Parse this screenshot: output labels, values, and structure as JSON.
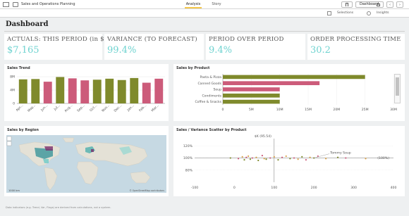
{
  "app": {
    "title": "Sales and Operations Planning"
  },
  "tabs": [
    {
      "label": "Analysis",
      "active": true
    },
    {
      "label": "Story",
      "active": false
    }
  ],
  "toolbar": {
    "bookmark_icon": "bookmark-icon",
    "sheet_select": "Dashboard"
  },
  "subtoolbar": {
    "selections_label": "Selections",
    "insights_label": "Insights"
  },
  "sheet": {
    "title": "Dashboard"
  },
  "kpis": [
    {
      "label": "ACTUALS: THIS PERIOD (in $K)",
      "value": "$7,165"
    },
    {
      "label": "VARIANCE (TO FORECAST)",
      "value": "99.4%"
    },
    {
      "label": "PERIOD OVER PERIOD",
      "value": "9.4%"
    },
    {
      "label": "ORDER PROCESSING TIME",
      "value": "30.2"
    }
  ],
  "colors": {
    "olive": "#7f8a2c",
    "pink": "#cc5b7a",
    "teal": "#6fd3d0",
    "accent_yellow": "#f5c84c"
  },
  "panels": {
    "sales_trend": {
      "title": "Sales Trend"
    },
    "sales_by_product": {
      "title": "Sales by Product"
    },
    "sales_by_region": {
      "title": "Sales by Region",
      "scale_label": "1000 km",
      "attribution": "© OpenStreetMap contributors"
    },
    "scatter": {
      "title": "Sales / Variance Scatter by Product",
      "annotation_top": "$K (95.54)",
      "annotation_point": "Tommy Soup",
      "annotation_right": "(100%)"
    }
  },
  "chart_data": [
    {
      "type": "bar",
      "title": "Sales Trend",
      "categories": [
        "Apr...",
        "May...",
        "Jun...",
        "Jul...",
        "Aug...",
        "Sep...",
        "Oct...",
        "Nov...",
        "Dec...",
        "Jan...",
        "Feb...",
        "Mar..."
      ],
      "values": [
        7.2,
        7.3,
        6.5,
        7.9,
        7.5,
        6.9,
        7.1,
        7.4,
        7.0,
        7.6,
        6.2,
        7.4
      ],
      "bar_colors": [
        "#7f8a2c",
        "#7f8a2c",
        "#cc5b7a",
        "#7f8a2c",
        "#cc5b7a",
        "#cc5b7a",
        "#7f8a2c",
        "#7f8a2c",
        "#7f8a2c",
        "#7f8a2c",
        "#cc5b7a",
        "#cc5b7a"
      ],
      "ylim": [
        0,
        8
      ],
      "yticks": [
        "0",
        "4M",
        "8M"
      ]
    },
    {
      "type": "bar",
      "orientation": "horizontal",
      "title": "Sales by Product",
      "categories": [
        "Pasta & Pizza",
        "Canned Goods",
        "Soup",
        "Condiments",
        "Coffee & Snacks"
      ],
      "values": [
        25,
        17,
        10,
        10,
        10
      ],
      "bar_colors": [
        "#7f8a2c",
        "#cc5b7a",
        "#cc5b7a",
        "#7f8a2c",
        "#7f8a2c"
      ],
      "xlim": [
        0,
        30
      ],
      "xticks": [
        "0",
        "5M",
        "10M",
        "15M",
        "20M",
        "25M",
        "30M"
      ]
    },
    {
      "type": "scatter",
      "title": "Sales / Variance Scatter by Product",
      "x": [
        -10,
        10,
        20,
        25,
        30,
        35,
        40,
        45,
        55,
        60,
        70,
        75,
        80,
        90,
        100,
        110,
        120,
        130,
        140,
        150,
        160,
        170,
        180,
        190,
        200,
        210,
        230,
        260,
        280,
        330
      ],
      "y": [
        100,
        99,
        102,
        97,
        101,
        103,
        98,
        100,
        101,
        96,
        104,
        99,
        98,
        100,
        102,
        97,
        101,
        103,
        99,
        100,
        98,
        102,
        97,
        101,
        100,
        103,
        99,
        101,
        100,
        99
      ],
      "xlim": [
        -100,
        400
      ],
      "ylim": [
        60,
        125
      ],
      "xticks": [
        "-100",
        "0",
        "100",
        "200",
        "300",
        "400"
      ],
      "yticks": [
        "120%",
        "100%",
        "80%"
      ],
      "reference_y": "100%",
      "reference_x": 100
    }
  ],
  "footnote": "Data indicators (e.g. Trend, Var, Flags) are derived from calculations, not a system."
}
